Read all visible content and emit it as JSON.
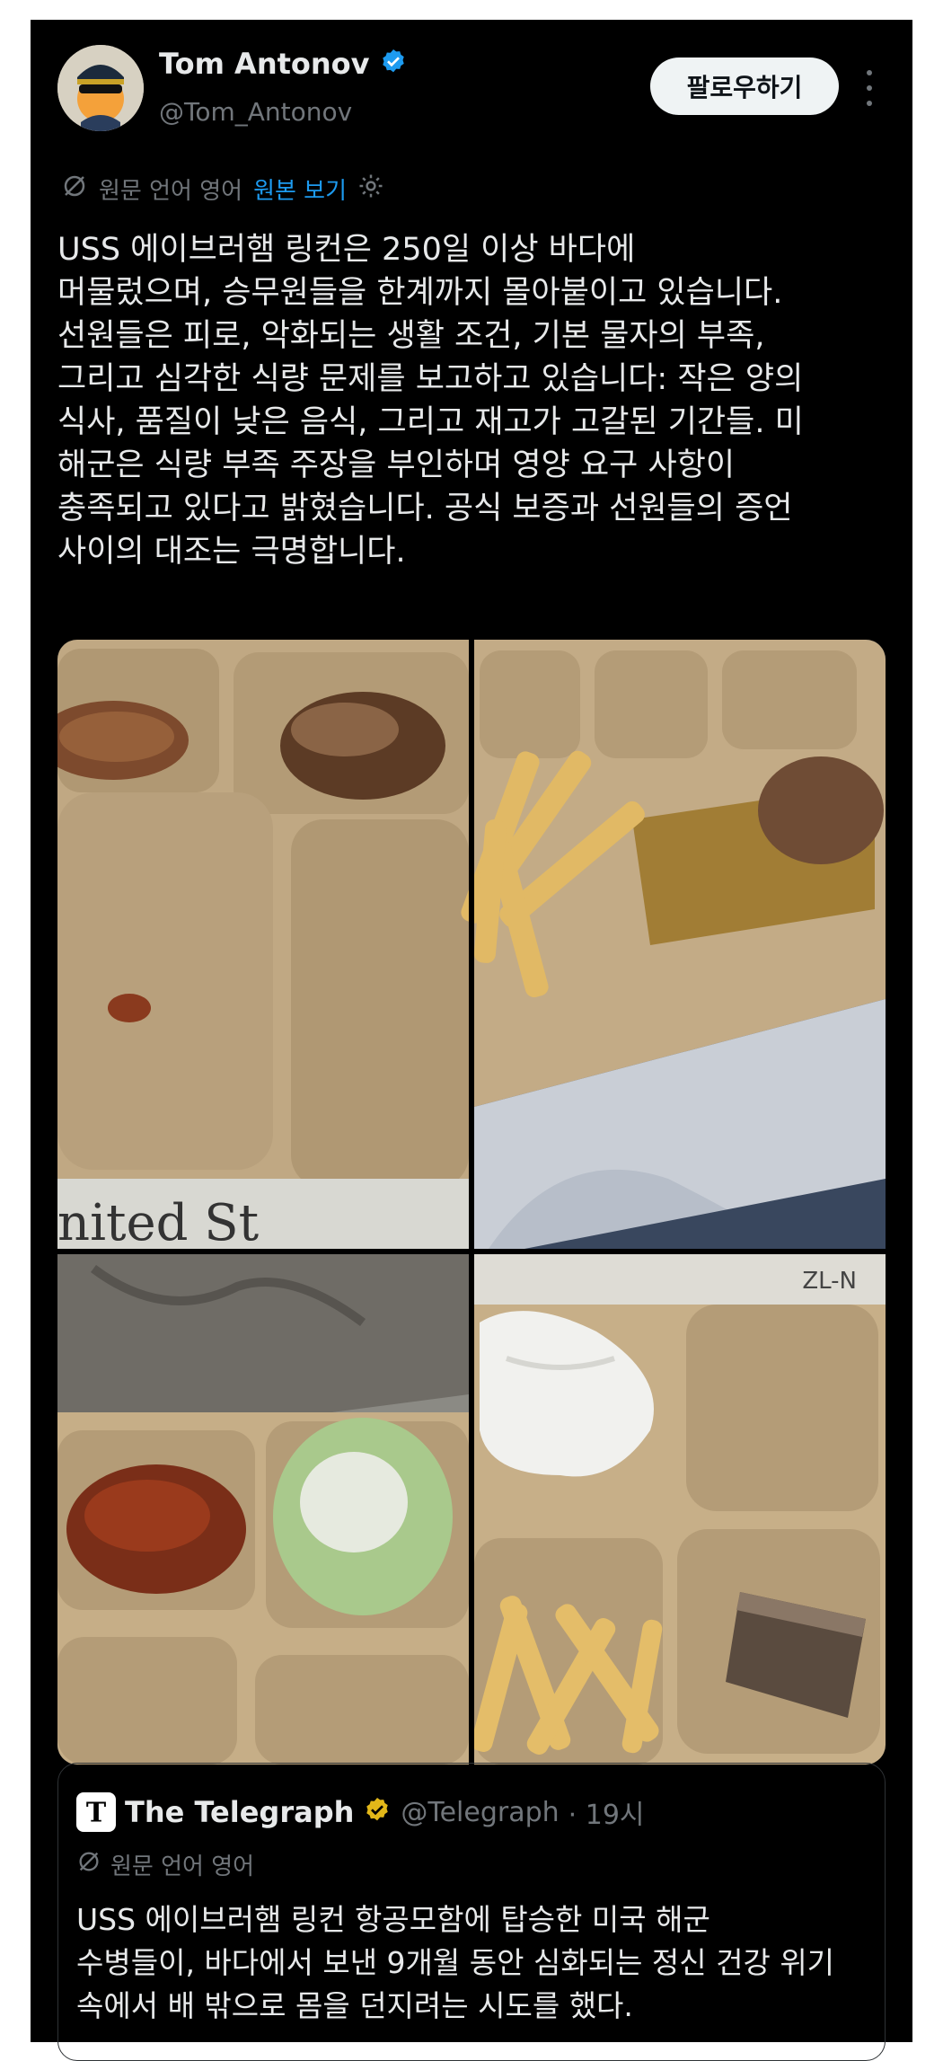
{
  "author": {
    "name": "Tom Antonov",
    "handle": "@Tom_Antonov",
    "verified_color": "#1d9bf0"
  },
  "follow_label": "팔로우하기",
  "translation": {
    "note": "원문 언어 영어",
    "show_original": "원본 보기"
  },
  "post_text": "USS 에이브러햄 링컨은 250일 이상 바다에\n머물렀으며, 승무원들을 한계까지 몰아붙이고 있습니다.\n선원들은 피로, 악화되는 생활 조건, 기본 물자의 부족,\n그리고 심각한 식량 문제를 보고하고 있습니다: 작은 양의\n식사, 품질이 낮은 음식, 그리고 재고가 고갈된 기간들. 미\n해군은 식량 부족 주장을 부인하며 영양 요구 사항이\n충족되고 있다고 밝혔습니다. 공식 보증과 선원들의 증언\n사이의 대조는 극명합니다.",
  "media": {
    "tray_text_1": "nited St",
    "tray_text_2": "ZL-N"
  },
  "quote": {
    "name": "The Telegraph",
    "handle": "@Telegraph",
    "time": "· 19시",
    "verified_color": "#e2b719",
    "translation_note": "원문 언어 영어",
    "text": "USS 에이브러햄 링컨 항공모함에 탑승한 미국 해군\n수병들이, 바다에서 보낸 9개월 동안 심화되는 정신 건강 위기\n속에서 배 밖으로 몸을 던지려는 시도를 했다."
  },
  "colors": {
    "background": "#000000",
    "text": "#e7e9ea",
    "secondary_text": "#71767b",
    "link": "#1d9bf0",
    "tray": "#c9b594"
  }
}
